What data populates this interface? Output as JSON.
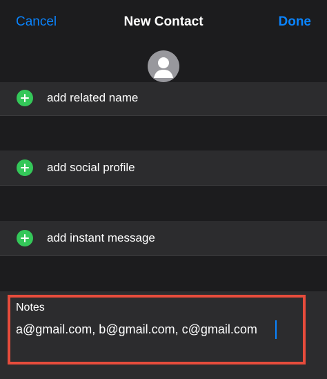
{
  "nav": {
    "cancel_label": "Cancel",
    "title": "New Contact",
    "done_label": "Done"
  },
  "avatar": {
    "icon": "person-icon"
  },
  "rows": [
    {
      "label": "add related name",
      "icon": "plus-circle-icon"
    },
    {
      "label": "add social profile",
      "icon": "plus-circle-icon"
    },
    {
      "label": "add instant message",
      "icon": "plus-circle-icon"
    }
  ],
  "notes": {
    "label": "Notes",
    "value": "a@gmail.com, b@gmail.com, c@gmail.com"
  },
  "colors": {
    "background": "#1c1c1e",
    "row_background": "#2c2c2e",
    "accent": "#0a84ff",
    "add_green": "#34c759",
    "highlight_red": "#e74c3c"
  }
}
